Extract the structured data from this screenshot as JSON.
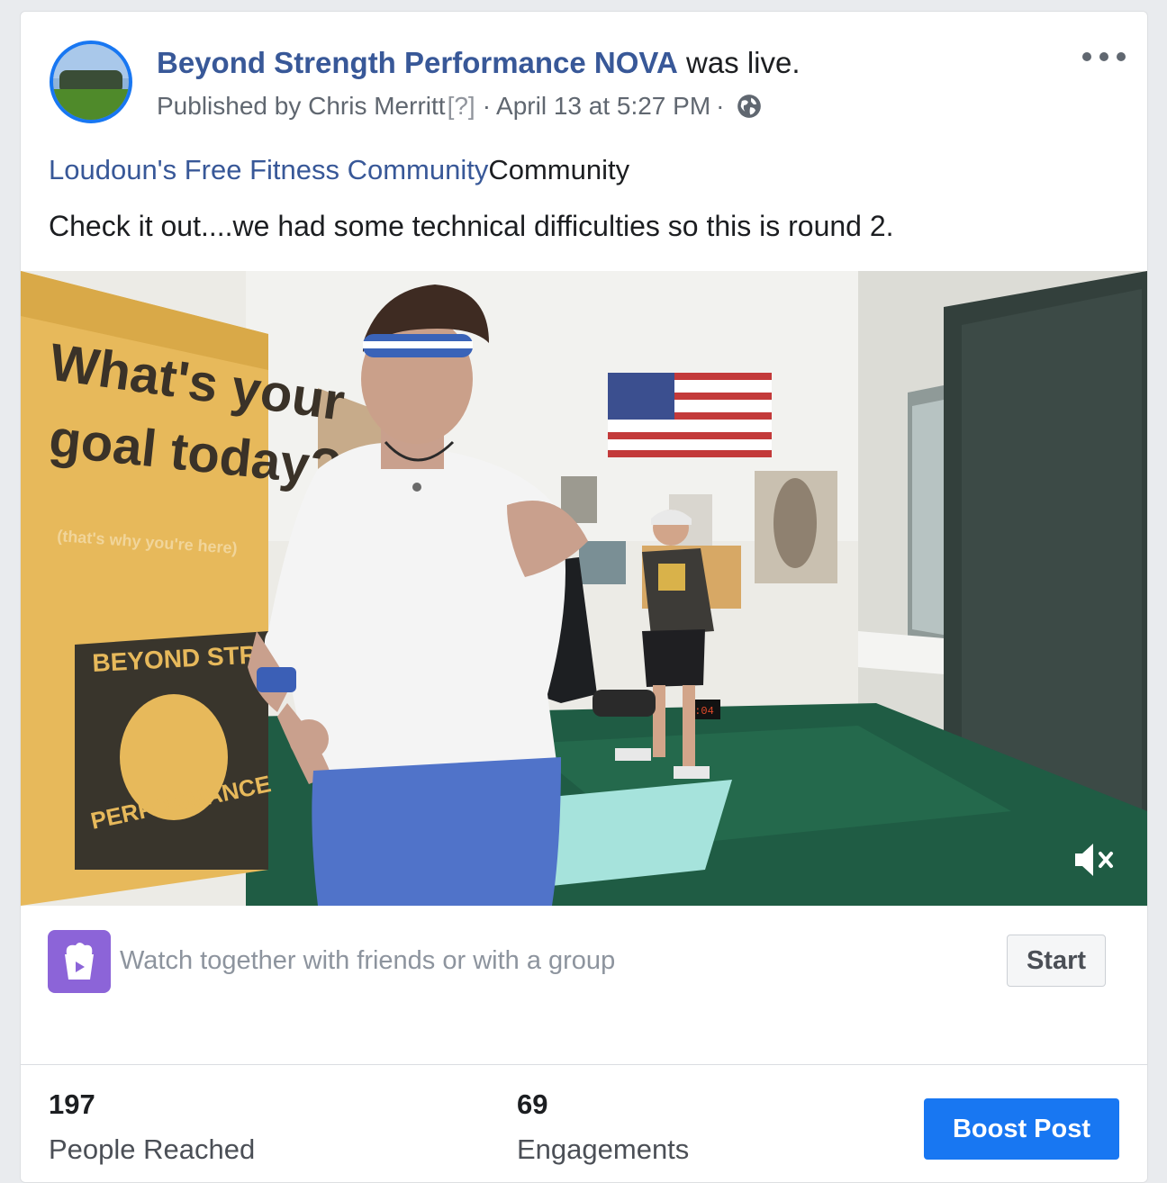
{
  "post": {
    "page_name": "Beyond Strength Performance NOVA",
    "status_suffix": " was live.",
    "published_by": "Published by Chris Merritt",
    "help_marker": "[?]",
    "separator": "·",
    "timestamp": "April 13 at 5:27 PM",
    "audience_icon": "globe-icon",
    "more_icon": "more-options-icon",
    "community_link": "Loudoun's Free Fitness Community",
    "community_suffix": "Community",
    "text": "Check it out....we had some technical difficulties so this is round 2."
  },
  "video": {
    "poster_text_line1": "What's your",
    "poster_text_line2": "goal today?",
    "poster_text_line3": "(that's why you're here)",
    "poster_brand": "BEYOND STRENGTH",
    "poster_brand2": "PERFORMANCE",
    "timer_display": "0:04",
    "mute_icon": "sound-muted-icon"
  },
  "watch_party": {
    "icon": "watch-party-icon",
    "label": "Watch together with friends or with a group",
    "start_label": "Start"
  },
  "insights": {
    "reached_value": "197",
    "reached_label": "People Reached",
    "engagements_value": "69",
    "engagements_label": "Engagements",
    "boost_label": "Boost Post"
  },
  "colors": {
    "link_blue": "#385898",
    "brand_blue": "#1877f2",
    "watch_purple": "#8c64d8"
  }
}
